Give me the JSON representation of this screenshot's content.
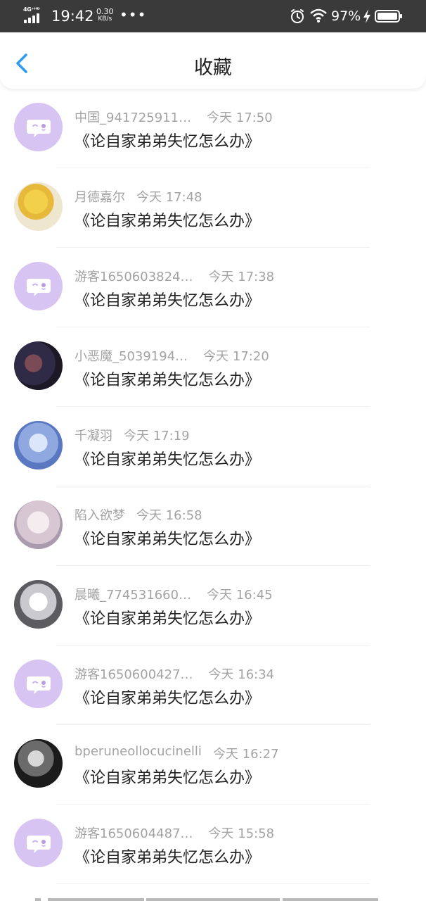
{
  "status_bar": {
    "network": "4G⁺ᴴᴰ",
    "time": "19:42",
    "speed_value": "0.30",
    "speed_unit": "KB/s",
    "more": "•••",
    "battery_percent": "97%"
  },
  "header": {
    "title": "收藏",
    "back_icon": "chevron-left-icon",
    "accent_color": "#2f9bf0"
  },
  "default_avatar_color": "#d7c4f2",
  "items": [
    {
      "name": "中国_941725911…",
      "time": "今天 17:50",
      "title": "《论自家弟弟失忆怎么办》",
      "avatar": "default-chat-avatar"
    },
    {
      "name": "月德嘉尔",
      "time": "今天 17:48",
      "title": "《论自家弟弟失忆怎么办》",
      "avatar": "anime-avatar"
    },
    {
      "name": "游客1650603824…",
      "time": "今天 17:38",
      "title": "《论自家弟弟失忆怎么办》",
      "avatar": "default-chat-avatar"
    },
    {
      "name": "小恶魔_5039194…",
      "time": "今天 17:20",
      "title": "《论自家弟弟失忆怎么办》",
      "avatar": "anime-avatar"
    },
    {
      "name": "千凝羽",
      "time": "今天 17:19",
      "title": "《论自家弟弟失忆怎么办》",
      "avatar": "anime-avatar"
    },
    {
      "name": "陷入欲梦",
      "time": "今天 16:58",
      "title": "《论自家弟弟失忆怎么办》",
      "avatar": "anime-avatar"
    },
    {
      "name": "晨曦_774531660…",
      "time": "今天 16:45",
      "title": "《论自家弟弟失忆怎么办》",
      "avatar": "anime-avatar"
    },
    {
      "name": "游客1650600427…",
      "time": "今天 16:34",
      "title": "《论自家弟弟失忆怎么办》",
      "avatar": "default-chat-avatar"
    },
    {
      "name": "bperuneollocucinelli",
      "time": "今天 16:27",
      "title": "《论自家弟弟失忆怎么办》",
      "avatar": "photo-avatar"
    },
    {
      "name": "游客1650604487…",
      "time": "今天 15:58",
      "title": "《论自家弟弟失忆怎么办》",
      "avatar": "default-chat-avatar"
    }
  ]
}
